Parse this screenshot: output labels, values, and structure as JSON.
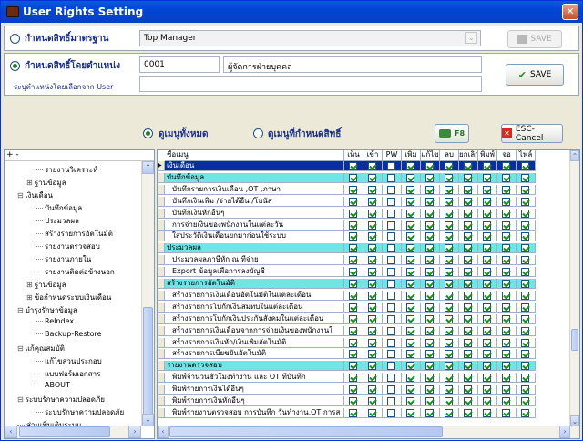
{
  "window": {
    "title": "User Rights Setting",
    "close_glyph": "✕"
  },
  "by_standard": {
    "label": "กำหนดสิทธิ์มาตรฐาน",
    "selected": false,
    "value": "Top Manager",
    "save_label": "SAVE"
  },
  "by_position": {
    "label": "กำหนดสิทธิ์โดยตำแหน่ง",
    "selected": true,
    "code": "0001",
    "name": "ผู้จัดการฝ่ายบุคคล",
    "hint": "ระบุตำแหน่งโดยเลือกจาก User",
    "save_label": "SAVE"
  },
  "view_filter": {
    "all_label": "ดูเมนูทั้งหมด",
    "all_selected": true,
    "assigned_label": "ดูเมนูที่กำหนดสิทธิ์",
    "assigned_selected": false
  },
  "f8_label": "F8",
  "esc_label": "ESC-Cancel",
  "tree": {
    "header": "+ -",
    "nodes": [
      {
        "label": "รายงานวิเคราะห์",
        "indent": 3
      },
      {
        "label": "ฐานข้อมูล",
        "indent": 2,
        "expander": "⊞"
      },
      {
        "label": "เงินเดือน",
        "indent": 1,
        "expander": "⊟"
      },
      {
        "label": "บันทึกข้อมูล",
        "indent": 3
      },
      {
        "label": "ประมวลผล",
        "indent": 3
      },
      {
        "label": "สร้างรายการอัตโนมัติ",
        "indent": 3
      },
      {
        "label": "รายงานตรวจสอบ",
        "indent": 3
      },
      {
        "label": "รายงานภายใน",
        "indent": 3
      },
      {
        "label": "รายงานติดต่อข้างนอก",
        "indent": 3
      },
      {
        "label": "ฐานข้อมูล",
        "indent": 2,
        "expander": "⊞"
      },
      {
        "label": "ข้อกำหนดระบบเงินเดือน",
        "indent": 2,
        "expander": "⊞"
      },
      {
        "label": "บำรุงรักษาข้อมูล",
        "indent": 1,
        "expander": "⊟"
      },
      {
        "label": "ReIndex",
        "indent": 3
      },
      {
        "label": "Backup-Restore",
        "indent": 3
      },
      {
        "label": "แก้คุณสมบัติ",
        "indent": 1,
        "expander": "⊟"
      },
      {
        "label": "แก้ไขส่วนประกอบ",
        "indent": 3
      },
      {
        "label": "แบบฟอร์มเอกสาร",
        "indent": 3
      },
      {
        "label": "ABOUT",
        "indent": 3
      },
      {
        "label": "ระบบรักษาความปลอดภัย",
        "indent": 1,
        "expander": "⊟"
      },
      {
        "label": "ระบบรักษาความปลอดภัย",
        "indent": 3
      },
      {
        "label": "ส่วนเพิ่มเติมระบบ",
        "indent": 1
      }
    ]
  },
  "grid": {
    "columns": [
      "ชื่อเมนู",
      "เห็น",
      "เข้า",
      "PW",
      "เพิ่ม",
      "แก้ไข",
      "ลบ",
      "ยกเลิก",
      "พิมพ์",
      "จอ",
      "ไฟล์"
    ],
    "rows": [
      {
        "name": "เงินเดือน",
        "kind": "selected",
        "perms": [
          1,
          1,
          0,
          1,
          1,
          1,
          1,
          1,
          1,
          1
        ]
      },
      {
        "name": "บันทึกข้อมูล",
        "kind": "group",
        "perms": [
          1,
          1,
          0,
          1,
          1,
          1,
          1,
          1,
          1,
          1
        ]
      },
      {
        "name": "บันทึกรายการเงินเดือน ,OT ,ภาษา",
        "kind": "item",
        "perms": [
          1,
          1,
          0,
          1,
          1,
          1,
          1,
          1,
          1,
          1
        ]
      },
      {
        "name": "บันทึกเงินเพิ่ม /จ่ายได้อื่น /โบนัส",
        "kind": "item",
        "perms": [
          1,
          1,
          0,
          1,
          1,
          1,
          1,
          1,
          1,
          1
        ]
      },
      {
        "name": "บันทึกเงินหักอื่นๆ",
        "kind": "item",
        "perms": [
          1,
          1,
          0,
          1,
          1,
          1,
          1,
          1,
          1,
          1
        ]
      },
      {
        "name": "การจ่ายเงินของพนักงานในแต่ละวัน",
        "kind": "item",
        "perms": [
          1,
          1,
          0,
          1,
          1,
          1,
          1,
          1,
          1,
          1
        ]
      },
      {
        "name": "ใส่ประวัติเงินเดือนยกมาก่อนใช้ระบบ",
        "kind": "item",
        "perms": [
          1,
          1,
          0,
          1,
          1,
          1,
          1,
          1,
          1,
          1
        ]
      },
      {
        "name": "ประมวลผล",
        "kind": "group",
        "perms": [
          1,
          1,
          0,
          1,
          1,
          1,
          1,
          1,
          1,
          1
        ]
      },
      {
        "name": "ประมวลผลภาษีหัก ณ ที่จ่าย",
        "kind": "item",
        "perms": [
          1,
          1,
          0,
          1,
          1,
          1,
          1,
          1,
          1,
          1
        ]
      },
      {
        "name": "Export ข้อมูลเพื่อการลงบัญชี",
        "kind": "item",
        "perms": [
          1,
          1,
          0,
          1,
          1,
          1,
          1,
          1,
          1,
          1
        ]
      },
      {
        "name": "สร้างรายการอัตโนมัติ",
        "kind": "group",
        "perms": [
          1,
          1,
          0,
          1,
          1,
          1,
          1,
          1,
          1,
          1
        ]
      },
      {
        "name": "สร้างรายการเงินเดือนอัตโนมัติในแต่ละเดือน",
        "kind": "item",
        "perms": [
          1,
          1,
          0,
          1,
          1,
          1,
          1,
          1,
          1,
          1
        ]
      },
      {
        "name": "สร้างรายการโบกักเงินสมทบในแต่ละเดือน",
        "kind": "item",
        "perms": [
          1,
          1,
          0,
          1,
          1,
          1,
          1,
          1,
          1,
          1
        ]
      },
      {
        "name": "สร้างรายการโบกักเงินประกันสังคมในแต่ละเดือน",
        "kind": "item",
        "perms": [
          1,
          1,
          0,
          1,
          1,
          1,
          1,
          1,
          1,
          1
        ]
      },
      {
        "name": "สร้างรายการเงินเดือนจากการจ่ายเงินของพนักงานใ",
        "kind": "item",
        "perms": [
          1,
          1,
          0,
          1,
          1,
          1,
          1,
          1,
          1,
          1
        ]
      },
      {
        "name": "สร้างรายการเงินหัก/เงินเพิ่มอัตโนมัติ",
        "kind": "item",
        "perms": [
          1,
          1,
          0,
          1,
          1,
          1,
          1,
          1,
          1,
          1
        ]
      },
      {
        "name": "สร้างรายการเบี้ยขยันอัตโนมัติ",
        "kind": "item",
        "perms": [
          1,
          1,
          0,
          1,
          1,
          1,
          1,
          1,
          1,
          1
        ]
      },
      {
        "name": "รายงานตรวจสอบ",
        "kind": "group",
        "perms": [
          1,
          1,
          0,
          1,
          1,
          1,
          1,
          1,
          1,
          1
        ]
      },
      {
        "name": "พิมพ์จำนวนชั่วโมงทำงาน และ OT ที่บันทึก",
        "kind": "item",
        "perms": [
          1,
          1,
          0,
          1,
          1,
          1,
          1,
          1,
          1,
          1
        ]
      },
      {
        "name": "พิมพ์รายการเงินได้อื่นๆ",
        "kind": "item",
        "perms": [
          1,
          1,
          0,
          1,
          1,
          1,
          1,
          1,
          1,
          1
        ]
      },
      {
        "name": "พิมพ์รายการเงินหักอื่นๆ",
        "kind": "item",
        "perms": [
          1,
          1,
          0,
          1,
          1,
          1,
          1,
          1,
          1,
          1
        ]
      },
      {
        "name": "พิมพ์รายงานตรวจสอบ การบันทึก วันทำงาน,OT,การส",
        "kind": "item",
        "perms": [
          1,
          1,
          0,
          1,
          1,
          1,
          1,
          1,
          1,
          1
        ]
      }
    ]
  }
}
